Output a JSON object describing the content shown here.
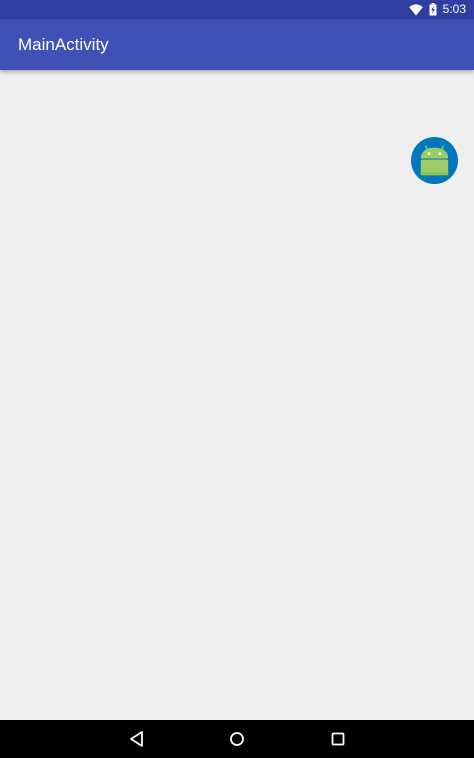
{
  "status_bar": {
    "time": "5:03",
    "background_color": "#303f9f",
    "icons": [
      "wifi-icon",
      "battery-charging-icon"
    ]
  },
  "app_bar": {
    "title": "MainActivity",
    "background_color": "#3f51b5"
  },
  "content": {
    "background_color": "#eeeeee",
    "image": {
      "icon": "android-launcher-icon",
      "circle_color": "#0277bd",
      "robot_color": "#9ccc65"
    }
  },
  "nav_bar": {
    "background_color": "#000000",
    "buttons": [
      "back-icon",
      "home-icon",
      "recents-icon"
    ]
  }
}
